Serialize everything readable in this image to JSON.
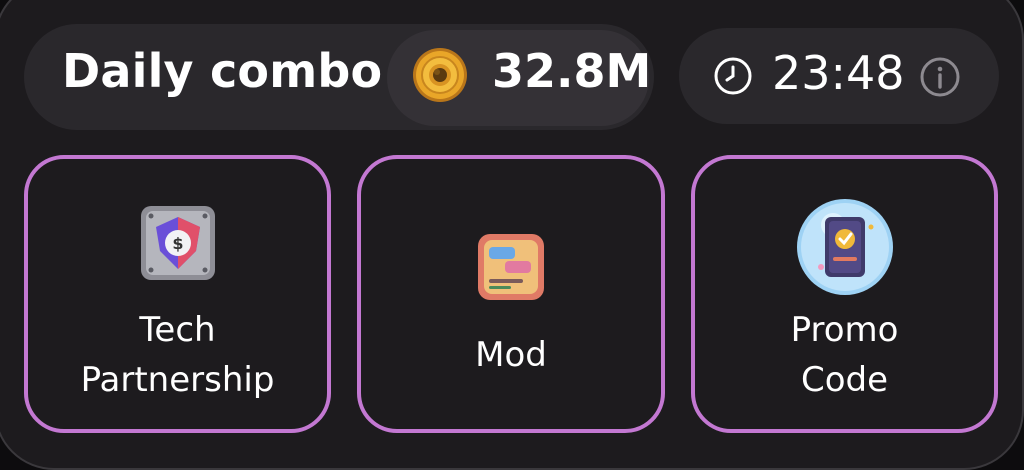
{
  "daily_combo": {
    "title": "Daily combo",
    "reward": "32.8M",
    "reward_icon": "coin-icon",
    "timer": "23:48",
    "timer_icon": "clock-icon",
    "info_icon": "info-icon"
  },
  "cards": [
    {
      "line1": "Tech",
      "line2": "Partnership",
      "icon": "shield-money-icon"
    },
    {
      "line1": "Mod",
      "icon": "chat-window-icon"
    },
    {
      "line1": "Promo",
      "line2": "Code",
      "icon": "ticket-badge-icon"
    }
  ],
  "colors": {
    "card_border": "#c378d2",
    "pill_bg": "#2a282c",
    "coin_gold": "#e9a628"
  }
}
